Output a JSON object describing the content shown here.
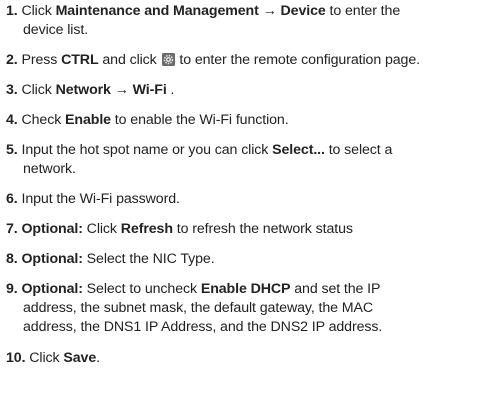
{
  "steps": [
    {
      "number": "1.",
      "parts": [
        "Click ",
        "Maintenance and Management",
        " → ",
        "Device",
        " to enter the",
        "device list."
      ]
    },
    {
      "number": "2.",
      "parts": [
        "Press ",
        "CTRL",
        " and click ",
        " to enter the remote configuration page."
      ],
      "icon": "settings-gear-icon"
    },
    {
      "number": "3.",
      "parts": [
        "Click ",
        "Network",
        " → ",
        "Wi-Fi",
        " ."
      ]
    },
    {
      "number": "4.",
      "parts": [
        "Check ",
        "Enable",
        " to enable the Wi-Fi function."
      ]
    },
    {
      "number": "5.",
      "parts": [
        "Input the hot spot name or you can click ",
        "Select...",
        " to select a",
        "network."
      ]
    },
    {
      "number": "6.",
      "parts": [
        "Input the Wi-Fi password."
      ]
    },
    {
      "number": "7.",
      "parts": [
        "Optional:",
        " Click ",
        "Refresh",
        " to refresh the network status"
      ]
    },
    {
      "number": "8.",
      "parts": [
        "Optional:",
        " Select the NIC Type."
      ]
    },
    {
      "number": "9.",
      "parts": [
        "Optional:",
        " Select to uncheck ",
        "Enable DHCP",
        " and set the IP",
        "address, the subnet mask, the default gateway, the MAC",
        "address, the DNS1 IP Address, and the DNS2 IP address."
      ]
    },
    {
      "number": "10.",
      "parts": [
        "Click ",
        "Save",
        "."
      ]
    }
  ],
  "colors": {
    "text": "#222222",
    "icon_bg": "#6b6b6b",
    "icon_fg": "#dcdcdc"
  }
}
